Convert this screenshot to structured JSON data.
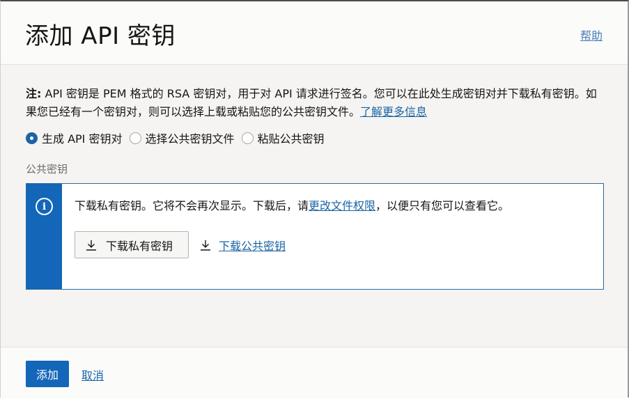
{
  "dialog": {
    "title": "添加 API 密钥",
    "help_link": "帮助"
  },
  "note": {
    "label": "注:",
    "text": " API 密钥是 PEM 格式的 RSA 密钥对，用于对 API 请求进行签名。您可以在此处生成密钥对并下载私有密钥。如果您已经有一个密钥对，则可以选择上载或粘贴您的公共密钥文件。",
    "learn_more_link": "了解更多信息"
  },
  "radio_options": [
    {
      "label": "生成 API 密钥对",
      "checked": true
    },
    {
      "label": "选择公共密钥文件",
      "checked": false
    },
    {
      "label": "粘贴公共密钥",
      "checked": false
    }
  ],
  "public_key_section": {
    "label": "公共密钥"
  },
  "info_box": {
    "icon": "info-icon",
    "icon_glyph": "i",
    "text_before": "下载私有密钥。它将不会再次显示。下载后，请",
    "permissions_link": "更改文件权限",
    "text_after": "，以便只有您可以查看它。",
    "download_private_label": "下载私有密钥",
    "download_public_label": "下载公共密钥"
  },
  "footer": {
    "add_button": "添加",
    "cancel_link": "取消"
  },
  "colors": {
    "primary": "#1366b8",
    "link": "#1b64a5",
    "info_border": "#2c6a9e"
  }
}
